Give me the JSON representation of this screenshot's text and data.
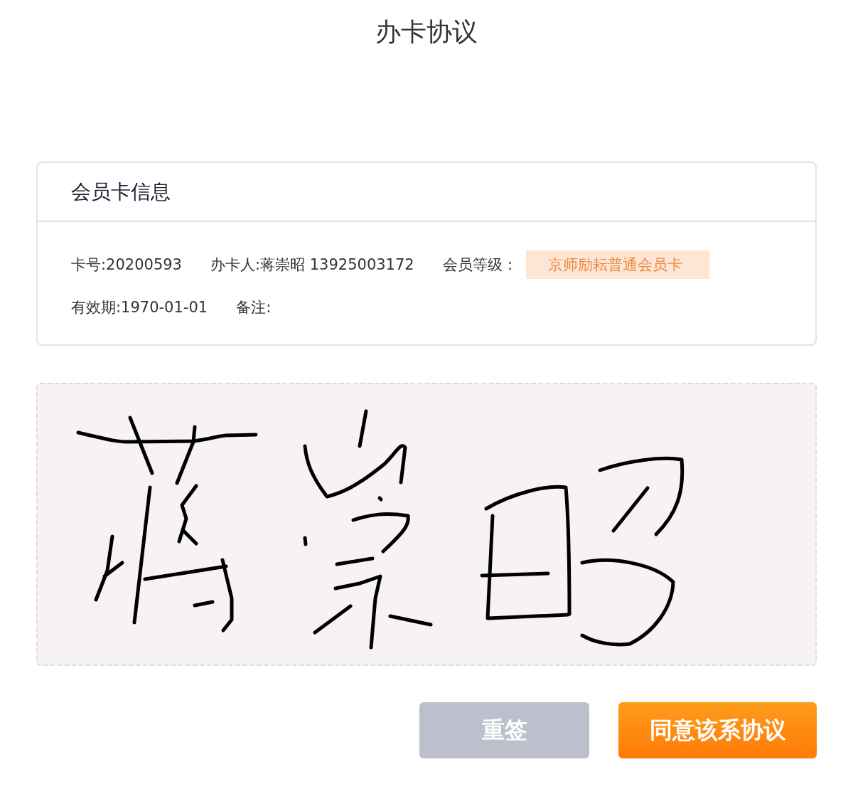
{
  "page": {
    "title": "办卡协议"
  },
  "card": {
    "title": "会员卡信息",
    "rows": [
      [
        {
          "kind": "text",
          "text": "卡号:20200593"
        },
        {
          "kind": "text",
          "text": "办卡人:蒋崇昭 13925003172"
        },
        {
          "kind": "text",
          "text": "会员等级："
        },
        {
          "kind": "badge",
          "text": "京师励耘普通会员卡"
        }
      ],
      [
        {
          "kind": "text",
          "text": "有效期:1970-01-01"
        },
        {
          "kind": "text",
          "text": "备注:"
        }
      ]
    ]
  },
  "buttons": [
    {
      "kind": "secondary",
      "label": "重签"
    },
    {
      "kind": "primary",
      "label": "同意该系协议"
    }
  ]
}
